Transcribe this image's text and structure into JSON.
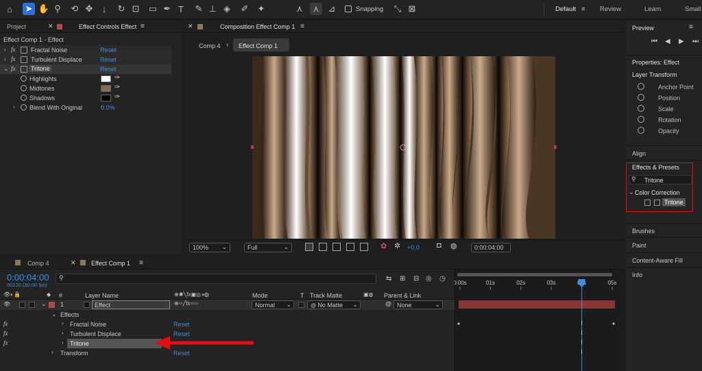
{
  "workspace": {
    "items": [
      "Default",
      "Review",
      "Learn",
      "Small"
    ]
  },
  "toolbar": {
    "snapping_label": "Snapping"
  },
  "left_panel": {
    "tabs": [
      "Project",
      "Effect Controls Effect"
    ],
    "header": "Effect Comp 1 - Effect",
    "effects": [
      {
        "name": "Fractal Noise",
        "reset": "Reset"
      },
      {
        "name": "Turbulent Displace",
        "reset": "Reset"
      },
      {
        "name": "Tritone",
        "reset": "Reset"
      }
    ],
    "tritone_props": [
      {
        "name": "Highlights",
        "color": "#ffffff"
      },
      {
        "name": "Midtones",
        "color": "#8a6a4c"
      },
      {
        "name": "Shadows",
        "color": "#000000"
      }
    ],
    "blend": {
      "name": "Blend With Original",
      "value": "0.0%"
    }
  },
  "composition": {
    "title": "Composition Effect Comp 1",
    "breadcrumb": [
      "Comp 4",
      "Effect Comp 1"
    ],
    "zoom": "100%",
    "resolution": "Full",
    "exposure": "+0.0",
    "timecode": "0:00:04:00"
  },
  "right_panel": {
    "preview_title": "Preview",
    "properties_title": "Properties: Effect",
    "layer_transform": "Layer Transform",
    "properties": [
      "Anchor Point",
      "Position",
      "Scale",
      "Rotation",
      "Opacity"
    ],
    "align": "Align",
    "effects_presets": "Effects & Presets",
    "search_value": "Tritone",
    "category": "Color Correction",
    "result": "Tritone",
    "panels": [
      "Brushes",
      "Paint",
      "Content-Aware Fill",
      "Info"
    ]
  },
  "timeline": {
    "tabs": [
      "Comp 4",
      "Effect Comp 1"
    ],
    "timecode": "0:00:04:00",
    "frames": "00120 (30.00 fps)",
    "columns": {
      "hash": "#",
      "layer_name": "Layer Name",
      "mode": "Mode",
      "t": "T",
      "track_matte": "Track Matte",
      "parent": "Parent & Link"
    },
    "layer": {
      "number": "1",
      "name": "Effect",
      "mode": "Normal",
      "matte": "No Matte",
      "parent": "None"
    },
    "effects_group": "Effects",
    "effects": [
      {
        "name": "Fractal Noise",
        "reset": "Reset"
      },
      {
        "name": "Turbulent Displace",
        "reset": "Reset"
      },
      {
        "name": "Tritone",
        "reset": ""
      }
    ],
    "transform": {
      "name": "Transform",
      "reset": "Reset"
    },
    "ruler": [
      "0:00s",
      "01s",
      "02s",
      "03s",
      "04s",
      "05s"
    ],
    "current_time_seconds": 4
  },
  "colors": {
    "accent": "#2e6ed8",
    "link": "#3f8de6",
    "highlight": "#e01010",
    "timecode": "#3f8de6"
  }
}
